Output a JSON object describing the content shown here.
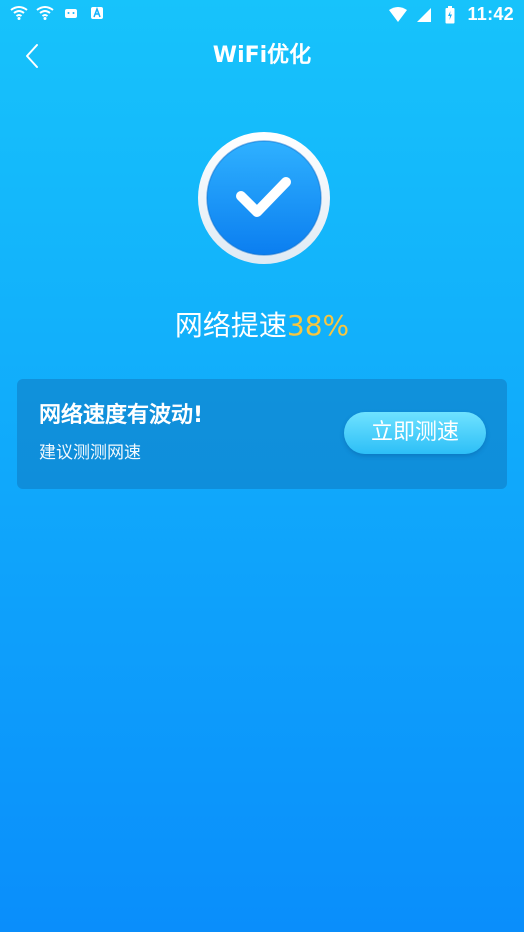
{
  "status_bar": {
    "time": "11:42",
    "left_icons": [
      "wifi-icon",
      "wifi-icon",
      "android-notification-icon",
      "a-notification-icon"
    ],
    "right_icons": [
      "wifi-signal-icon",
      "cellular-signal-icon",
      "battery-icon"
    ]
  },
  "header": {
    "title": "WiFi优化",
    "back_icon": "chevron-left-icon"
  },
  "result": {
    "icon": "check-circle-icon",
    "speed_label": "网络提速",
    "speed_percent": "38%"
  },
  "card": {
    "title": "网络速度有波动!",
    "subtitle": "建议测测网速",
    "button_label": "立即测速"
  },
  "colors": {
    "background_top": "#17c3fb",
    "background_bottom": "#0a8efb",
    "accent_percent": "#f7c640",
    "button": "#2dbff7"
  }
}
